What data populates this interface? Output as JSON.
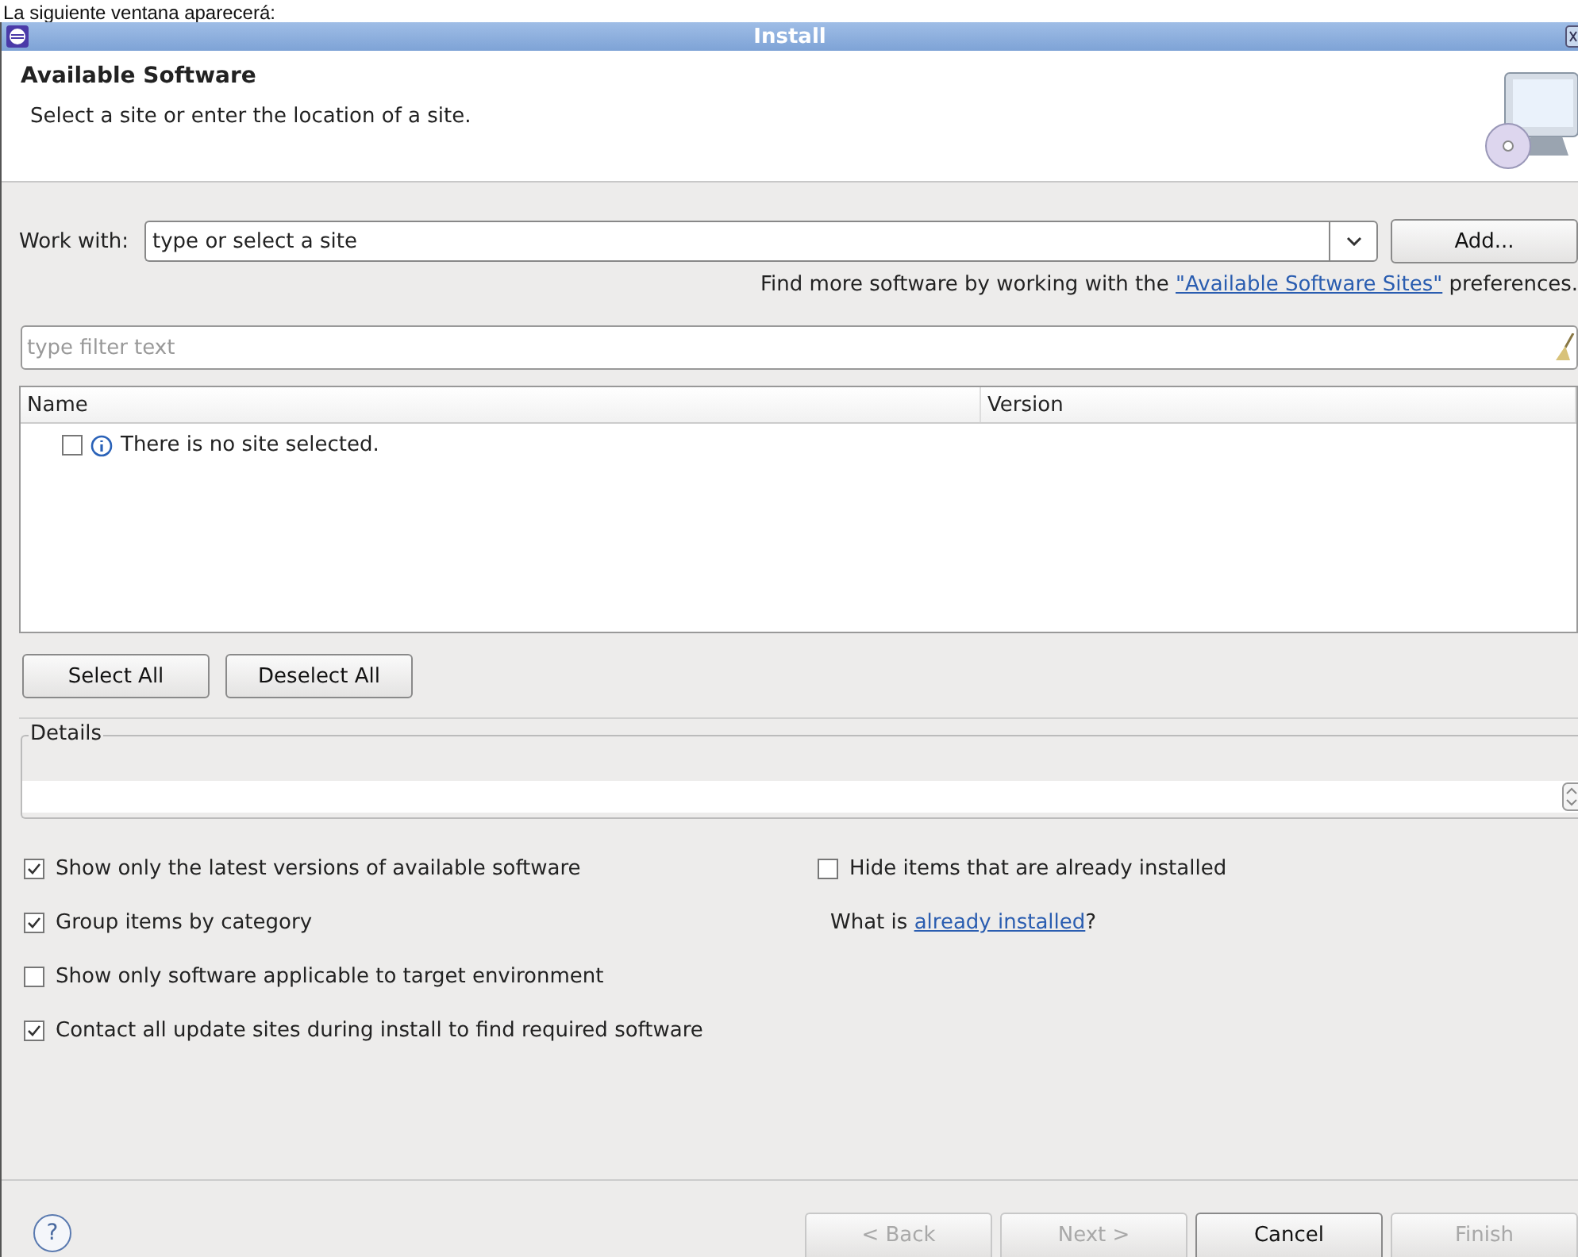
{
  "caption": "La siguiente ventana aparecerá:",
  "window": {
    "title": "Install"
  },
  "header": {
    "title": "Available Software",
    "description": "Select a site or enter the location of a site."
  },
  "work_with": {
    "label": "Work with:",
    "placeholder": "type or select a site",
    "add_button": "Add..."
  },
  "hint": {
    "before": "Find more software by working with the ",
    "link": "\"Available Software Sites\"",
    "after": " preferences."
  },
  "filter": {
    "placeholder": "type filter text"
  },
  "table": {
    "columns": [
      "Name",
      "Version"
    ],
    "rows": [
      {
        "checked": false,
        "text": "There is no site selected."
      }
    ]
  },
  "selection_buttons": [
    "Select All",
    "Deselect All"
  ],
  "details": {
    "label": "Details"
  },
  "options": [
    {
      "label": "Show only the latest versions of available software",
      "checked": true
    },
    {
      "label": "Group items by category",
      "checked": true
    },
    {
      "label": "Show only software applicable to target environment",
      "checked": false
    },
    {
      "label": "Contact all update sites during install to find required software",
      "checked": true
    }
  ],
  "side_option": {
    "label": "Hide items that are already installed",
    "checked": false
  },
  "installed": {
    "before": "What is ",
    "link": "already installed",
    "after": "?"
  },
  "help_glyph": "?",
  "footer_buttons": [
    {
      "label": "< Back",
      "disabled": true
    },
    {
      "label": "Next >",
      "disabled": true
    },
    {
      "label": "Cancel",
      "disabled": false
    },
    {
      "label": "Finish",
      "disabled": true
    }
  ]
}
